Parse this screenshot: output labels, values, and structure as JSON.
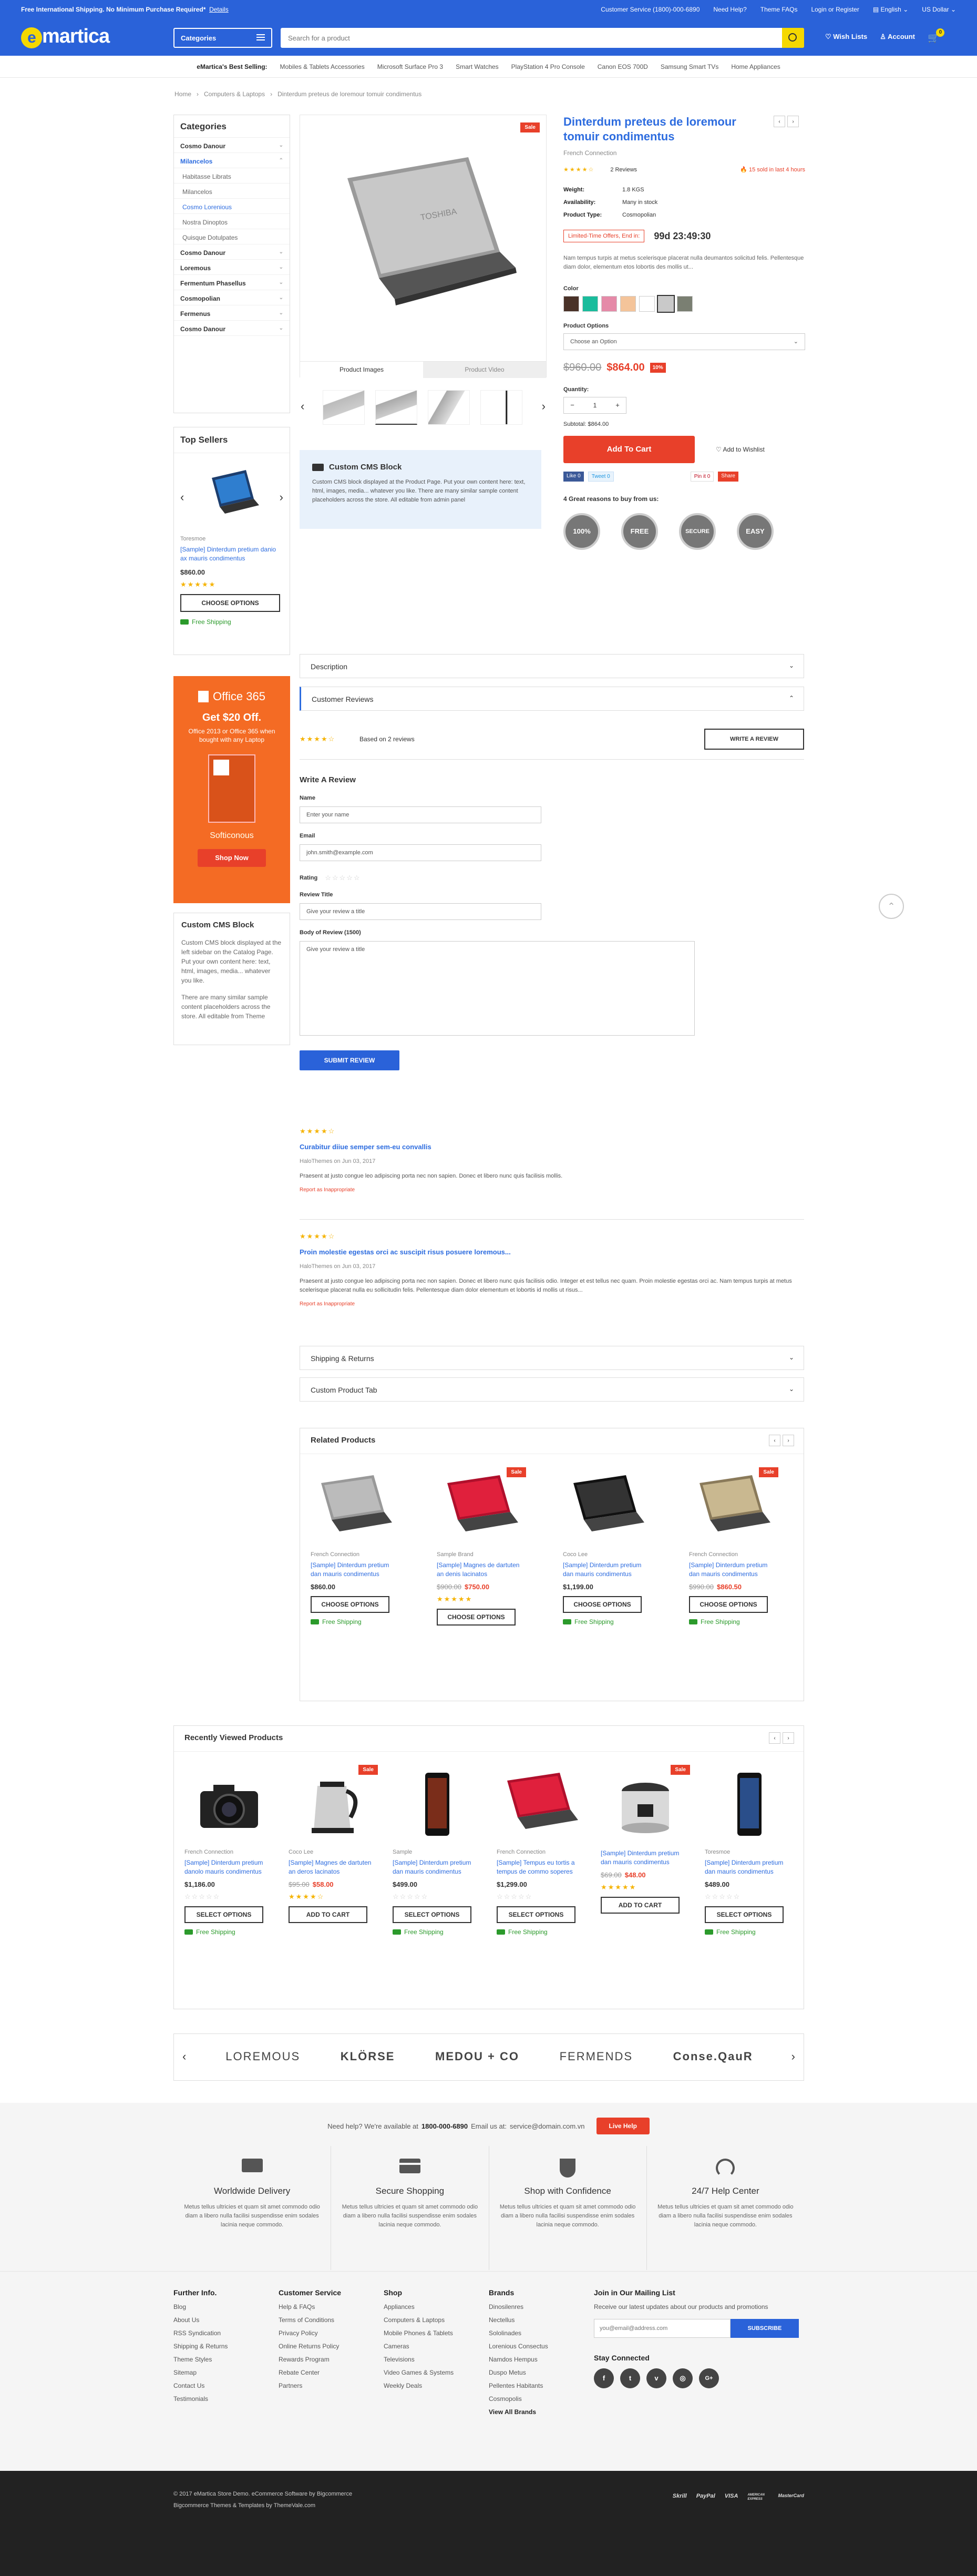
{
  "topbar": {
    "promo_bold": "Free International Shipping. No Minimum Purchase Required*",
    "promo_link": "Details",
    "links": [
      "Customer Service (1800)-000-6890",
      "Need Help?",
      "Theme FAQs",
      "Login or Register",
      "English",
      "US Dollar"
    ]
  },
  "header": {
    "logo_rest": "martica",
    "categories_label": "Categories",
    "search_placeholder": "Search for a product",
    "wishlist": "Wish Lists",
    "account": "Account",
    "cart_count": "0"
  },
  "best_selling": {
    "label": "eMartica's Best Selling:",
    "items": [
      "Mobiles & Tablets Accessories",
      "Microsoft Surface Pro 3",
      "Smart Watches",
      "PlayStation 4 Pro Console",
      "Canon EOS 700D",
      "Samsung Smart TVs",
      "Home Appliances"
    ]
  },
  "breadcrumb": [
    "Home",
    "Computers & Laptops",
    "Dinterdum preteus de loremour tomuir condimentus"
  ],
  "sidebar": {
    "categories_title": "Categories",
    "categories": [
      {
        "label": "Cosmo Danour",
        "type": "main",
        "chev": "⌄"
      },
      {
        "label": "Milancelos",
        "type": "sel",
        "chev": "⌃"
      },
      {
        "label": "Habitasse Librats",
        "type": "sub",
        "chev": ""
      },
      {
        "label": "Milancelos",
        "type": "sub",
        "chev": ""
      },
      {
        "label": "Cosmo Lorenious",
        "type": "subsel",
        "chev": ""
      },
      {
        "label": "Nostra Dinoptos",
        "type": "sub",
        "chev": ""
      },
      {
        "label": "Quisque Dotulpates",
        "type": "sub",
        "chev": ""
      },
      {
        "label": "Cosmo Danour",
        "type": "main",
        "chev": "⌄"
      },
      {
        "label": "Loremous",
        "type": "main",
        "chev": "⌄"
      },
      {
        "label": "Fermentum Phasellus",
        "type": "main",
        "chev": "⌄"
      },
      {
        "label": "Cosmopolian",
        "type": "main",
        "chev": "⌄"
      },
      {
        "label": "Fermenus",
        "type": "main",
        "chev": "⌄"
      },
      {
        "label": "Cosmo Danour",
        "type": "main",
        "chev": "⌄"
      }
    ],
    "top_sellers_title": "Top Sellers",
    "top_seller": {
      "brand": "Toresmoe",
      "name": "[Sample] Dinterdum pretium danio ax mauris condimentus",
      "price": "$860.00",
      "button": "Choose Options",
      "shipping": "Free Shipping"
    },
    "promo": {
      "brand": "Office 365",
      "headline": "Get $20 Off.",
      "sub": "Office 2013 or Office 365 when bought with any Laptop",
      "maker": "Softiconous",
      "button": "Shop Now"
    },
    "cms": {
      "title": "Custom CMS Block",
      "p1": "Custom CMS block displayed at the left sidebar on the Catalog Page. Put your own content here: text, html, images, media... whatever you like.",
      "p2": "There are many similar sample content placeholders across the store. All editable from Theme"
    }
  },
  "product": {
    "sale_badge": "Sale",
    "title": "Dinterdum preteus de loremour tomuir condimentus",
    "brand": "French Connection",
    "reviews": "2 Reviews",
    "sold": "15 sold in last 4 hours",
    "rating": "★★★★☆",
    "attributes": [
      {
        "k": "Weight:",
        "v": "1.8 KGS"
      },
      {
        "k": "Availability:",
        "v": "Many in stock"
      },
      {
        "k": "Product Type:",
        "v": "Cosmopolian"
      }
    ],
    "offer_label": "Limited-Time Offers, End in:",
    "countdown": "99d 23:49:30",
    "desc": "Nam tempus turpis at metus scelerisque placerat nulla deumantos solicitud felis. Pellentesque diam dolor, elementum etos lobortis des mollis ut...",
    "color_label": "Color",
    "colors": [
      "#4a3228",
      "#1abc9c",
      "#e58aa8",
      "#f4c49a",
      "#ffffff",
      "#c9c9c9",
      "#7a7f72"
    ],
    "options_label": "Product Options",
    "options_value": "Choose an Option",
    "price_old": "$960.00",
    "price_new": "$864.00",
    "discount": "10%",
    "qty_label": "Quantity:",
    "qty": "1",
    "subtotal": "Subtotal: $864.00",
    "add_to_cart": "Add To Cart",
    "wishlist": "Add to Wishlist",
    "share": [
      "Like 0",
      "Tweet 0",
      "Pin it 0",
      "Share"
    ],
    "reasons_title": "4 Great reasons to buy from us:",
    "reasons": [
      "100%",
      "FREE",
      "SECURE",
      "EASY"
    ],
    "tabs": [
      "Product Images",
      "Product Video"
    ]
  },
  "cms_block": {
    "title": "Custom CMS Block",
    "text": "Custom CMS block displayed at the Product Page. Put your own content here: text, html, images, media... whatever you like. There are many similar sample content placeholders across the store. All editable from admin panel"
  },
  "tabs": {
    "description": "Description",
    "reviews": "Customer Reviews",
    "shipping": "Shipping & Returns",
    "custom": "Custom Product Tab"
  },
  "reviews": {
    "based": "Based on 2 reviews",
    "write_btn": "Write A Review",
    "form_title": "Write A Review",
    "name_label": "Name",
    "name_value": "Enter your name",
    "email_label": "Email",
    "email_value": "john.smith@example.com",
    "rating_label": "Rating",
    "title_label": "Review Title",
    "title_value": "Give your review a title",
    "body_label": "Body of Review (1500)",
    "body_value": "Give your review a title",
    "submit": "Submit Review",
    "items": [
      {
        "stars": "★★★★☆",
        "title": "Curabitur diiue semper sem-eu convallis",
        "meta": "HaloThemes on Jun 03, 2017",
        "body": "Praesent at justo congue leo adipiscing porta nec non sapien. Donec et libero nunc quis facilisis mollis.",
        "report": "Report as Inappropriate"
      },
      {
        "stars": "★★★★☆",
        "title": "Proin molestie egestas orci ac suscipit risus posuere loremous...",
        "meta": "HaloThemes on Jun 03, 2017",
        "body": "Praesent at justo congue leo adipiscing porta nec non sapien. Donec et libero nunc quis facilisis odio. Integer et est tellus nec quam. Proin molestie egestas orci ac. Nam tempus turpis at metus scelerisque placerat nulla eu sollicitudin felis. Pellentesque diam dolor elementum et lobortis id mollis ut risus...",
        "report": "Report as Inappropriate"
      }
    ]
  },
  "related": {
    "title": "Related Products",
    "items": [
      {
        "brand": "French Connection",
        "name": "[Sample] Dinterdum pretium dan mauris condimentus",
        "old": "",
        "price": "$860.00",
        "sale": "",
        "btn": "Choose Options",
        "ship": "Free Shipping",
        "stars": "",
        "img": "laptop-silver"
      },
      {
        "brand": "Sample Brand",
        "name": "[Sample] Magnes de dartuten an denis lacinatos",
        "old": "$900.00",
        "price": "$750.00",
        "sale": "Sale",
        "btn": "Choose Options",
        "ship": "",
        "stars": "★★★★★",
        "img": "laptop-red"
      },
      {
        "brand": "Coco Lee",
        "name": "[Sample] Dinterdum pretium dan mauris condimentus",
        "old": "",
        "price": "$1,199.00",
        "sale": "",
        "btn": "Choose Options",
        "ship": "Free Shipping",
        "stars": "",
        "img": "laptop-black"
      },
      {
        "brand": "French Connection",
        "name": "[Sample] Dinterdum pretium dan mauris condimentus",
        "old": "$990.00",
        "price": "$860.50",
        "sale": "Sale",
        "btn": "Choose Options",
        "ship": "Free Shipping",
        "stars": "",
        "img": "laptop-gold"
      }
    ]
  },
  "recent": {
    "title": "Recently Viewed Products",
    "items": [
      {
        "brand": "French Connection",
        "name": "[Sample] Dinterdum pretium danolo mauris condimentus",
        "old": "",
        "price": "$1,186.00",
        "sale": "",
        "btn": "Select Options",
        "ship": "Free Shipping",
        "stars": "☆☆☆☆☆",
        "img": "camera"
      },
      {
        "brand": "Coco Lee",
        "name": "[Sample] Magnes de dartuten an deros lacinatos",
        "old": "$95.00",
        "price": "$58.00",
        "sale": "Sale",
        "btn": "Add To Cart",
        "ship": "",
        "stars": "★★★★☆",
        "img": "kettle"
      },
      {
        "brand": "Sample",
        "name": "[Sample] Dinterdum pretium dan mauris condimentus",
        "old": "",
        "price": "$499.00",
        "sale": "",
        "btn": "Select Options",
        "ship": "Free Shipping",
        "stars": "☆☆☆☆☆",
        "img": "phone"
      },
      {
        "brand": "French Connection",
        "name": "[Sample] Tempus eu tortis a tempus de commo soperes",
        "old": "",
        "price": "$1,299.00",
        "sale": "",
        "btn": "Select Options",
        "ship": "Free Shipping",
        "stars": "☆☆☆☆☆",
        "img": "laptop-red"
      },
      {
        "brand": "",
        "name": "[Sample] Dinterdum pretium dan mauris condimentus",
        "old": "$69.00",
        "price": "$48.00",
        "sale": "Sale",
        "btn": "Add To Cart",
        "ship": "",
        "stars": "★★★★★",
        "img": "cooker"
      },
      {
        "brand": "Toresmoe",
        "name": "[Sample] Dinterdum pretium dan mauris condimentus",
        "old": "",
        "price": "$489.00",
        "sale": "",
        "btn": "Select Options",
        "ship": "Free Shipping",
        "stars": "☆☆☆☆☆",
        "img": "phone2"
      }
    ]
  },
  "brands_row": [
    "LOREMOUS",
    "KLÖRSE",
    "MEDOU + CO",
    "FERMENDS",
    "Conse.QauR"
  ],
  "help": {
    "text1": "Need help? We're available at",
    "phone": "1800-000-6890",
    "text2": "Email us at:",
    "email": "service@domain.com.vn",
    "button": "Live Help"
  },
  "features": [
    {
      "title": "Worldwide Delivery",
      "text": "Metus tellus ultricies et quam sit amet commodo odio diam a libero nulla facilisi suspendisse enim sodales lacinia neque commodo."
    },
    {
      "title": "Secure Shopping",
      "text": "Metus tellus ultricies et quam sit amet commodo odio diam a libero nulla facilisi suspendisse enim sodales lacinia neque commodo."
    },
    {
      "title": "Shop with Confidence",
      "text": "Metus tellus ultricies et quam sit amet commodo odio diam a libero nulla facilisi suspendisse enim sodales lacinia neque commodo."
    },
    {
      "title": "24/7 Help Center",
      "text": "Metus tellus ultricies et quam sit amet commodo odio diam a libero nulla facilisi suspendisse enim sodales lacinia neque commodo."
    }
  ],
  "footer": {
    "cols": [
      {
        "title": "Further Info.",
        "links": [
          "Blog",
          "About Us",
          "RSS Syndication",
          "Shipping & Returns",
          "Theme Styles",
          "Sitemap",
          "Contact Us",
          "Testimonials"
        ]
      },
      {
        "title": "Customer Service",
        "links": [
          "Help & FAQs",
          "Terms of Conditions",
          "Privacy Policy",
          "Online Returns Policy",
          "Rewards Program",
          "Rebate Center",
          "Partners"
        ]
      },
      {
        "title": "Shop",
        "links": [
          "Appliances",
          "Computers & Laptops",
          "Mobile Phones & Tablets",
          "Cameras",
          "Televisions",
          "Video Games & Systems",
          "Weekly Deals"
        ]
      },
      {
        "title": "Brands",
        "links": [
          "Dinosilenres",
          "Nectellus",
          "Sololinades",
          "Lorenious Consectus",
          "Namdos Hempus",
          "Duspo Metus",
          "Pellentes Habitants",
          "Cosmopolis",
          "View All Brands"
        ]
      }
    ],
    "mail_title": "Join in Our Mailing List",
    "mail_text": "Receive our latest updates about our products and promotions",
    "mail_placeholder": "you@email@address.com",
    "subscribe": "Subscribe",
    "stay": "Stay Connected",
    "social": [
      "f",
      "t",
      "v",
      "◎",
      "G+"
    ],
    "copyright": "© 2017 eMartica Store Demo. eCommerce Software by Bigcommerce",
    "credit": "Bigcommerce Themes & Templates by ThemeVale.com",
    "payments": [
      "Skrill",
      "PayPal",
      "VISA",
      "AMERICAN EXPRESS",
      "MasterCard"
    ]
  }
}
